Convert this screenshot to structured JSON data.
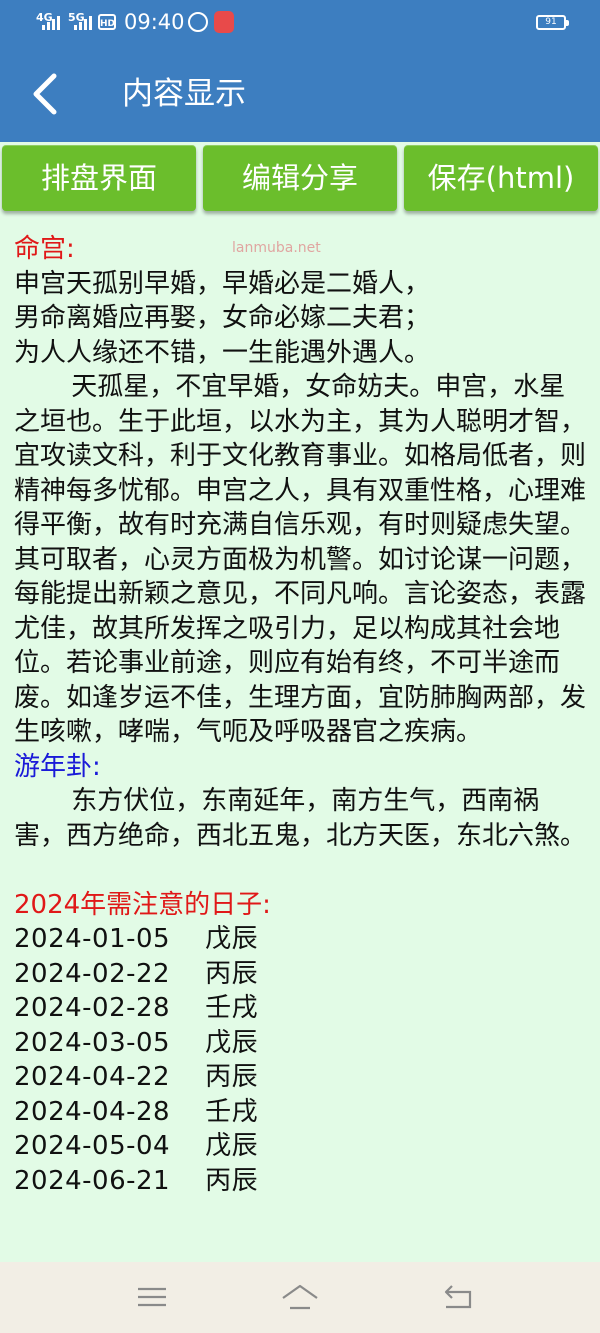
{
  "status_bar": {
    "signal1": "4G",
    "signal2": "5G",
    "hd": "HD",
    "time": "09:40",
    "battery": "91"
  },
  "app_bar": {
    "title": "内容显示",
    "back_icon": "chevron-left-icon"
  },
  "toolbar": {
    "buttons": [
      "排盘界面",
      "编辑分享",
      "保存(html)"
    ],
    "accent": "#6bbe2c"
  },
  "watermark": "lanmuba.net",
  "content": {
    "palace_heading": "命宫:",
    "poem": [
      "申宫天孤别早婚，早婚必是二婚人，",
      "男命离婚应再娶，女命必嫁二夫君；",
      "为人人缘还不错，一生能遇外遇人。"
    ],
    "palace_text": "天孤星，不宜早婚，女命妨夫。申宫，水星之垣也。生于此垣，以水为主，其为人聪明才智，宜攻读文科，利于文化教育事业。如格局低者，则精神每多忧郁。申宫之人，具有双重性格，心理难得平衡，故有时充满自信乐观，有时则疑虑失望。其可取者，心灵方面极为机警。如讨论谋一问题，每能提出新颖之意见，不同凡响。言论姿态，表露尤佳，故其所发挥之吸引力，足以构成其社会地位。若论事业前途，则应有始有终，不可半途而废。如逢岁运不佳，生理方面，宜防肺胸两部，发生咳嗽，哮喘，气呃及呼吸器官之疾病。",
    "gua_heading": "游年卦:",
    "gua_text": "东方伏位，东南延年，南方生气，西南祸害，西方绝命，西北五鬼，北方天医，东北六煞。",
    "dates_heading": "2024年需注意的日子:",
    "dates": [
      {
        "date": "2024-01-05",
        "ganzhi": "戊辰"
      },
      {
        "date": "2024-02-22",
        "ganzhi": "丙辰"
      },
      {
        "date": "2024-02-28",
        "ganzhi": "壬戌"
      },
      {
        "date": "2024-03-05",
        "ganzhi": "戊辰"
      },
      {
        "date": "2024-04-22",
        "ganzhi": "丙辰"
      },
      {
        "date": "2024-04-28",
        "ganzhi": "壬戌"
      },
      {
        "date": "2024-05-04",
        "ganzhi": "戊辰"
      },
      {
        "date": "2024-06-21",
        "ganzhi": "丙辰"
      }
    ],
    "colors": {
      "red_heading": "#e01818",
      "blue_heading": "#1a1ad8",
      "background": "#e2fbe6"
    }
  },
  "nav_bar": {
    "icons": [
      "menu-icon",
      "home-icon",
      "back-icon"
    ]
  }
}
